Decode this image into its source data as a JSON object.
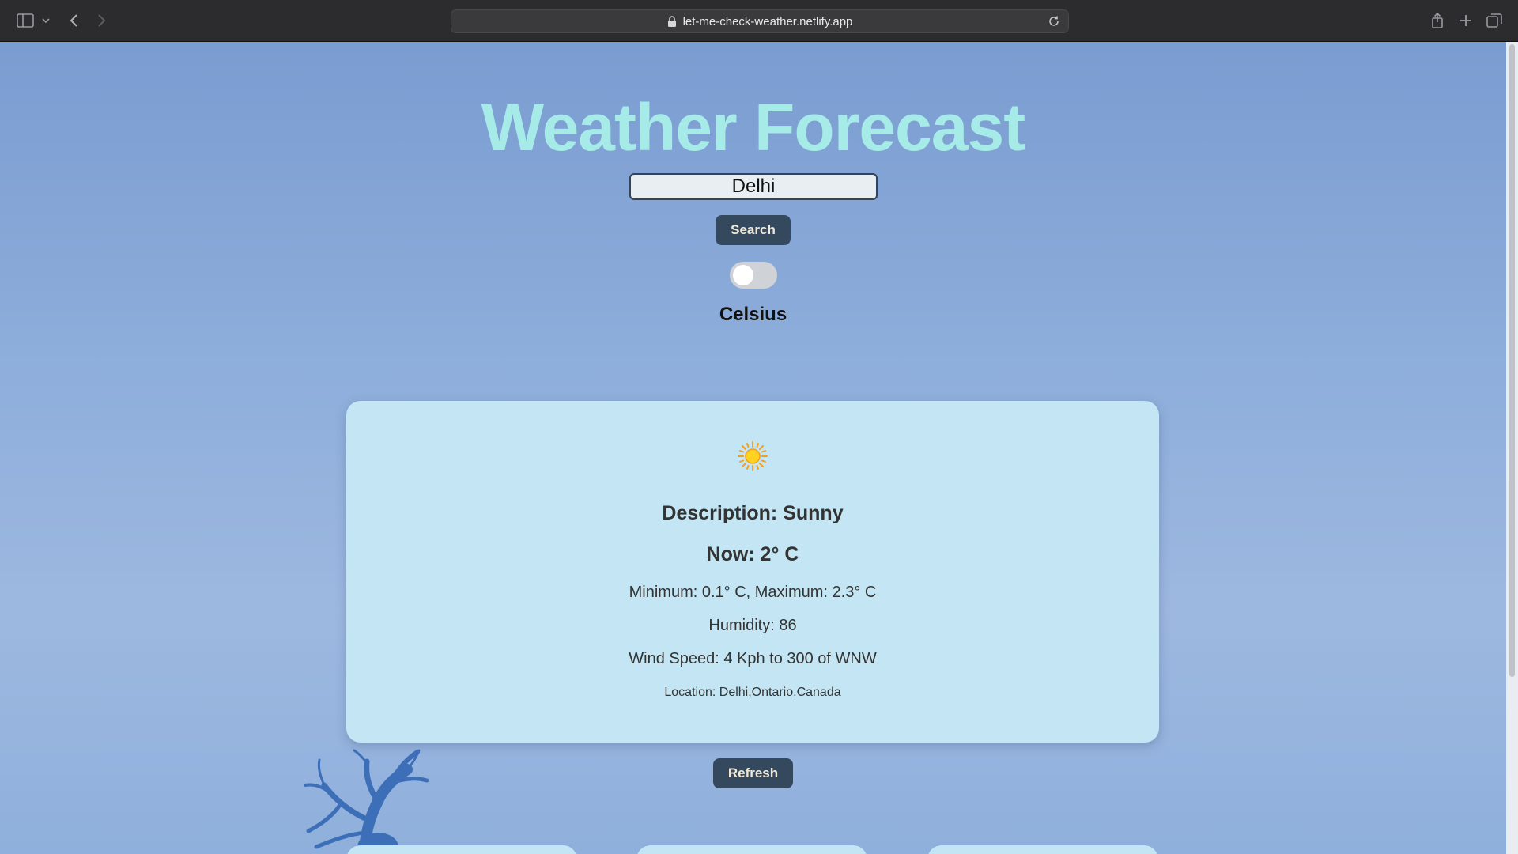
{
  "browser": {
    "url": "let-me-check-weather.netlify.app"
  },
  "page": {
    "title": "Weather Forecast",
    "search": {
      "value": "Delhi",
      "button_label": "Search"
    },
    "unit_toggle": {
      "on": false,
      "label": "Celsius"
    },
    "current": {
      "icon": "sun-icon",
      "description": "Description: Sunny",
      "now": "Now: 2° C",
      "min_max": "Minimum: 0.1° C, Maximum: 2.3° C",
      "humidity": "Humidity: 86",
      "wind": "Wind Speed: 4 Kph to 300 of WNW",
      "location": "Location: Delhi,Ontario,Canada"
    },
    "refresh_label": "Refresh"
  },
  "colors": {
    "title": "#a7ebe9",
    "card": "#c4e6f4",
    "button": "#34495e"
  }
}
